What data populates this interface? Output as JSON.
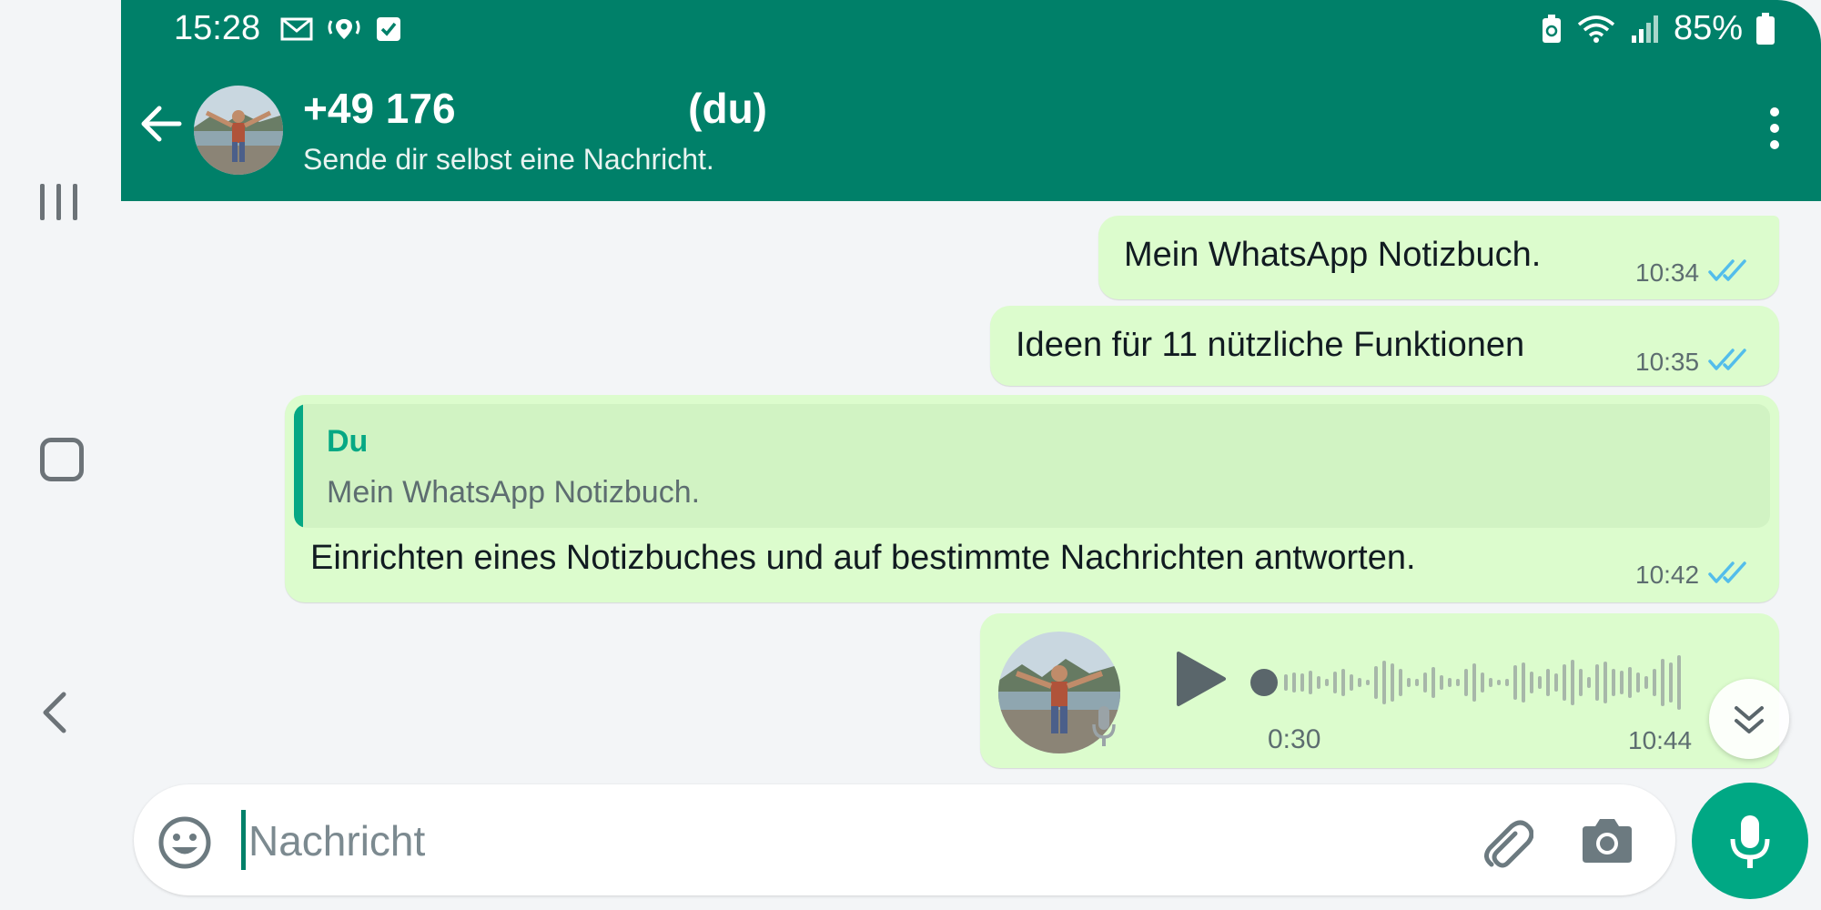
{
  "status_bar": {
    "time": "15:28",
    "battery": "85%"
  },
  "header": {
    "contact_name": "+49 176                    (du)",
    "subtitle": "Sende dir selbst eine Nachricht."
  },
  "messages": [
    {
      "text": "Mein WhatsApp Notizbuch.",
      "time": "10:34"
    },
    {
      "text": "Ideen für 11 nützliche Funktionen",
      "time": "10:35"
    },
    {
      "quote_author": "Du",
      "quote_text": "Mein WhatsApp Notizbuch.",
      "text": "Einrichten eines Notizbuches und auf bestimmte Nachrichten antworten.",
      "time": "10:42"
    },
    {
      "voice_duration": "0:30",
      "time": "10:44"
    }
  ],
  "composer": {
    "placeholder": "Nachricht"
  },
  "colors": {
    "header": "#008069",
    "bubble": "#dcfccd",
    "accent": "#00a884",
    "read_ticks": "#53bdeb"
  },
  "icons": [
    "back-arrow-icon",
    "menu-dots-icon",
    "play-icon",
    "mic-icon",
    "emoji-icon",
    "attach-icon",
    "camera-icon",
    "scroll-down-icon"
  ]
}
